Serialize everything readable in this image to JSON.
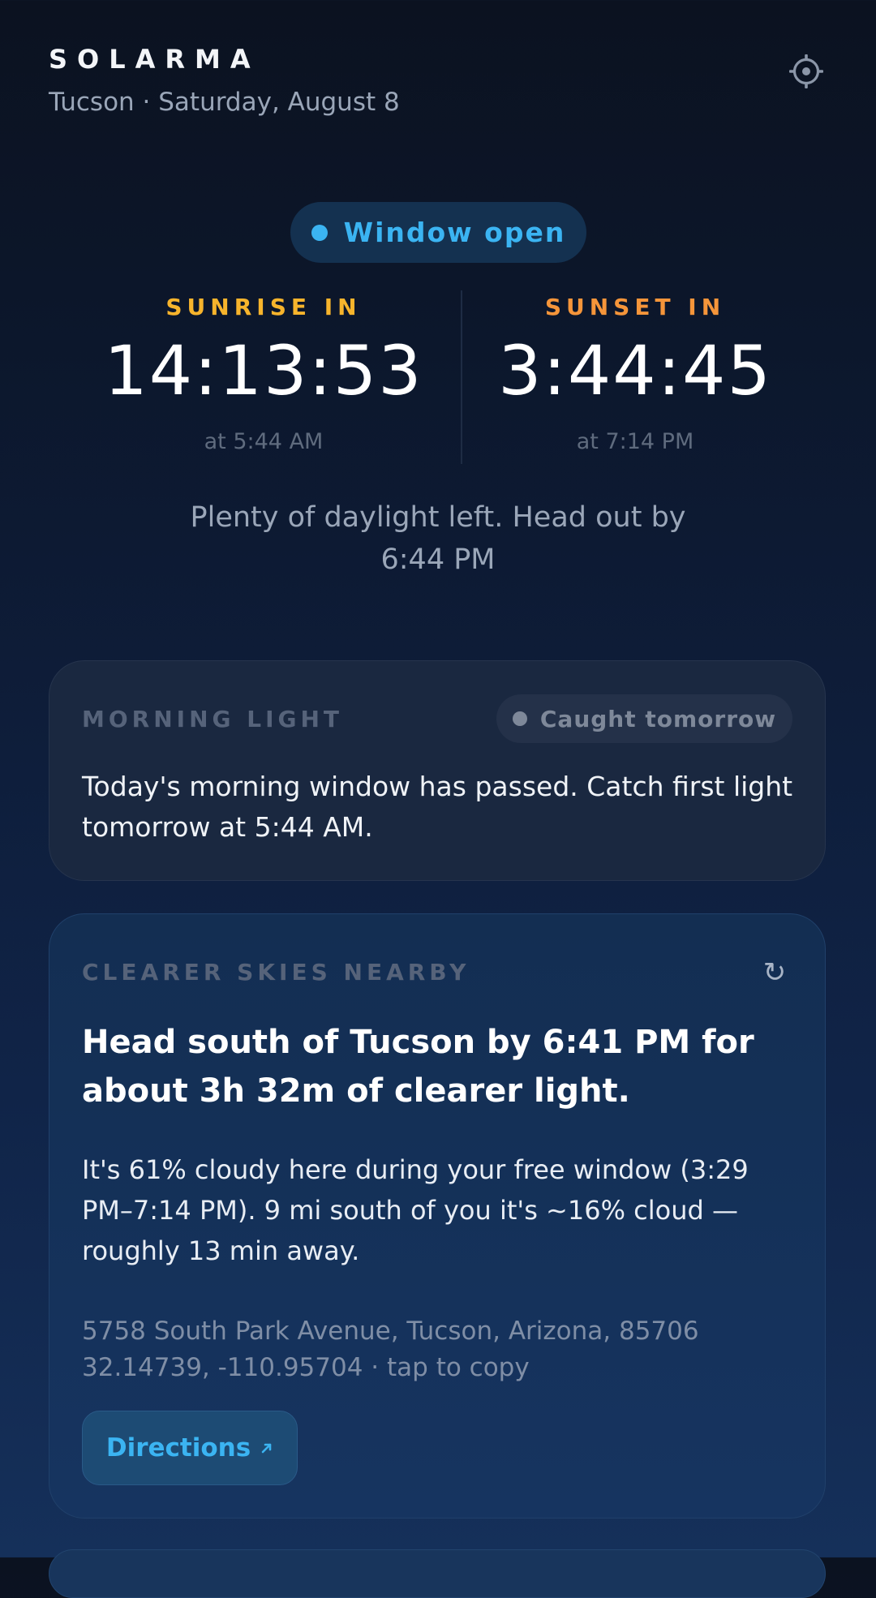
{
  "header": {
    "app_name": "SOLARMA",
    "subtitle": "Tucson · Saturday, August 8",
    "settings_icon": "gear-icon"
  },
  "status": {
    "label": "Window open",
    "color": "#3bb4f2"
  },
  "countdown": {
    "sunrise": {
      "label": "SUNRISE IN",
      "value": "14:13:53",
      "at": "at 5:44 AM",
      "color": "#f7b42c"
    },
    "sunset": {
      "label": "SUNSET IN",
      "value": "3:44:45",
      "at": "at 7:14 PM",
      "color": "#f5953a"
    },
    "advice": "Plenty of daylight left. Head out by 6:44 PM"
  },
  "morning_card": {
    "label": "MORNING LIGHT",
    "badge": "Caught tomorrow",
    "body": "Today's morning window has passed. Catch first light tomorrow at 5:44 AM."
  },
  "skies_card": {
    "label": "CLEARER SKIES NEARBY",
    "refresh_icon": "refresh-icon",
    "refresh_glyph": "↻",
    "headline": "Head south of Tucson by 6:41 PM for about 3h 32m of clearer light.",
    "detail": "It's 61% cloudy here during your free window (3:29 PM–7:14 PM). 9 mi south of you it's ~16% cloud — roughly 13 min away.",
    "address": "5758 South Park Avenue, Tucson, Arizona, 85706",
    "coords": "32.14739, -110.95704 · tap to copy",
    "directions_label": "Directions",
    "directions_icon": "external-arrow-icon"
  }
}
